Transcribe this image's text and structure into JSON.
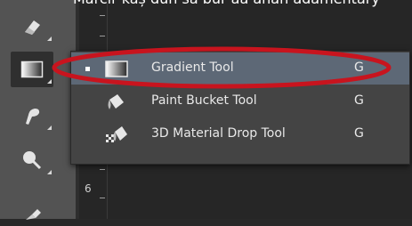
{
  "header": {
    "caption": "Marcír kaș dun sa bur aa ahan adamentary"
  },
  "ruler": {
    "number": "6"
  },
  "toolbar": {
    "tools": [
      {
        "icon": "eraser-icon"
      },
      {
        "icon": "gradient-icon",
        "active": true
      },
      {
        "icon": "blur-smudge-icon"
      },
      {
        "icon": "dodge-icon"
      },
      {
        "icon": "pen-icon"
      }
    ]
  },
  "flyout": {
    "items": [
      {
        "label": "Gradient Tool",
        "shortcut": "G",
        "icon": "gradient-icon",
        "selected": true
      },
      {
        "label": "Paint Bucket Tool",
        "shortcut": "G",
        "icon": "paint-bucket-icon",
        "selected": false
      },
      {
        "label": "3D Material Drop Tool",
        "shortcut": "G",
        "icon": "3d-material-drop-icon",
        "selected": false
      }
    ]
  },
  "annotation": {
    "color": "#c8141e"
  },
  "colors": {
    "selection": "#5d6876",
    "menu_bg": "#444444",
    "toolbar_bg": "#535353"
  }
}
